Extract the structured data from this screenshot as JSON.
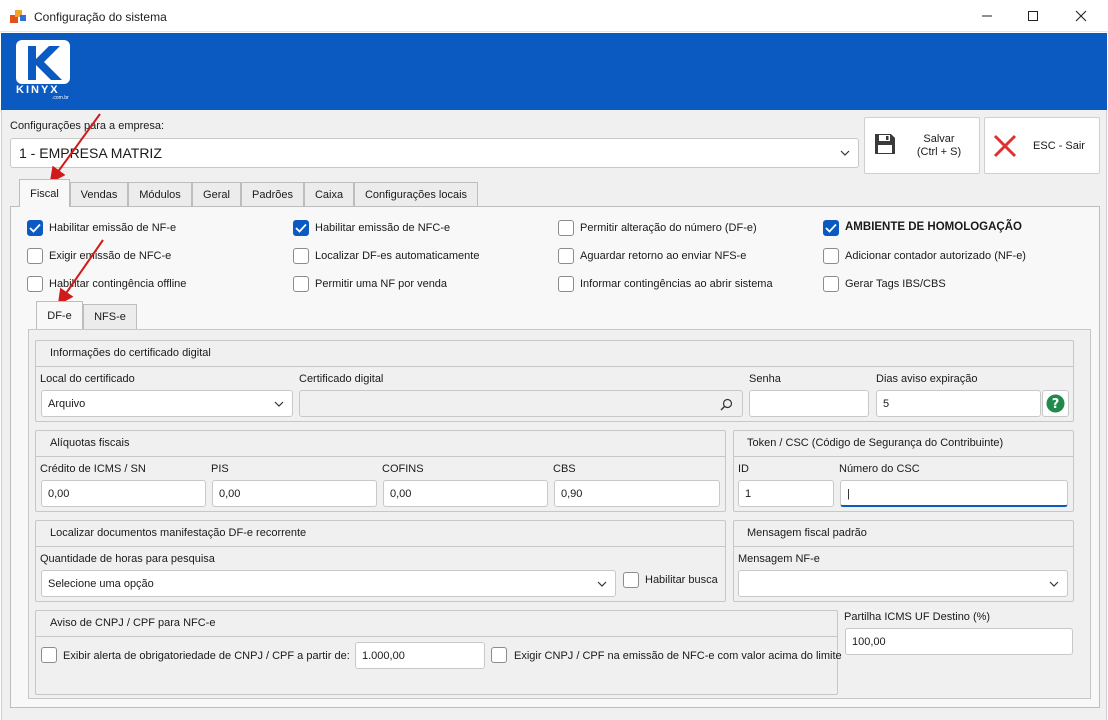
{
  "window": {
    "title": "Configuração do sistema",
    "min_icon": "minimize-icon",
    "max_icon": "maximize-icon",
    "close_icon": "close-icon"
  },
  "brand": {
    "logo_text": "KINYX",
    "logo_sub": ".com.br",
    "color": "#0a5ac2"
  },
  "empresa": {
    "label": "Configurações para a empresa:",
    "selected": "1 - EMPRESA MATRIZ"
  },
  "toolbar": {
    "save_line1": "Salvar",
    "save_line2": "(Ctrl + S)",
    "exit_label": "ESC - Sair"
  },
  "tabs": [
    {
      "label": "Fiscal",
      "active": true
    },
    {
      "label": "Vendas"
    },
    {
      "label": "Módulos"
    },
    {
      "label": "Geral"
    },
    {
      "label": "Padrões"
    },
    {
      "label": "Caixa"
    },
    {
      "label": "Configurações locais"
    }
  ],
  "fiscal_options": [
    {
      "label": "Habilitar emissão de NF-e",
      "checked": true
    },
    {
      "label": "Exigir emissão de NFC-e",
      "checked": false
    },
    {
      "label": "Habilitar contingência offline",
      "checked": false
    },
    {
      "label": "Habilitar emissão de NFC-e",
      "checked": true
    },
    {
      "label": "Localizar DF-es automaticamente",
      "checked": false
    },
    {
      "label": "Permitir uma NF por venda",
      "checked": false
    },
    {
      "label": "Permitir alteração do número (DF-e)",
      "checked": false
    },
    {
      "label": "Aguardar retorno ao enviar NFS-e",
      "checked": false
    },
    {
      "label": "Informar contingências ao abrir sistema",
      "checked": false
    },
    {
      "label": "AMBIENTE DE HOMOLOGAÇÃO",
      "checked": true
    },
    {
      "label": "Adicionar contador autorizado (NF-e)",
      "checked": false
    },
    {
      "label": "Gerar Tags IBS/CBS",
      "checked": false
    }
  ],
  "subtabs": [
    {
      "label": "DF-e",
      "active": true
    },
    {
      "label": "NFS-e"
    }
  ],
  "certificado": {
    "title": "Informações do certificado digital",
    "local_label": "Local do certificado",
    "local_value": "Arquivo",
    "cert_label": "Certificado digital",
    "cert_value": "",
    "senha_label": "Senha",
    "senha_value": "",
    "dias_label": "Dias aviso expiração",
    "dias_value": "5"
  },
  "aliquotas": {
    "title": "Alíquotas fiscais",
    "icms_label": "Crédito de ICMS / SN",
    "icms_value": "0,00",
    "pis_label": "PIS",
    "pis_value": "0,00",
    "cofins_label": "COFINS",
    "cofins_value": "0,00",
    "cbs_label": "CBS",
    "cbs_value": "0,90"
  },
  "token": {
    "title": "Token / CSC (Código de Segurança do Contribuinte)",
    "id_label": "ID",
    "id_value": "1",
    "csc_label": "Número do CSC",
    "csc_value": "|"
  },
  "manifestacao": {
    "title": "Localizar documentos manifestação DF-e recorrente",
    "horas_label": "Quantidade de horas para pesquisa",
    "horas_value": "Selecione uma opção",
    "busca_label": "Habilitar busca"
  },
  "mensagem": {
    "title": "Mensagem fiscal padrão",
    "nfe_label": "Mensagem NF-e",
    "nfe_value": ""
  },
  "aviso": {
    "title": "Aviso de CNPJ / CPF para NFC-e",
    "alerta_label": "Exibir alerta de obrigatoriedade de CNPJ / CPF a partir de:",
    "valor": "1.000,00",
    "exigir_label": "Exigir CNPJ / CPF na emissão de NFC-e com valor acima do limite"
  },
  "partilha": {
    "label": "Partilha ICMS UF Destino (%)",
    "value": "100,00"
  },
  "colors": {
    "accent": "#0a5ac2",
    "arrow": "#d11a1a",
    "help": "#1f8a4c"
  }
}
